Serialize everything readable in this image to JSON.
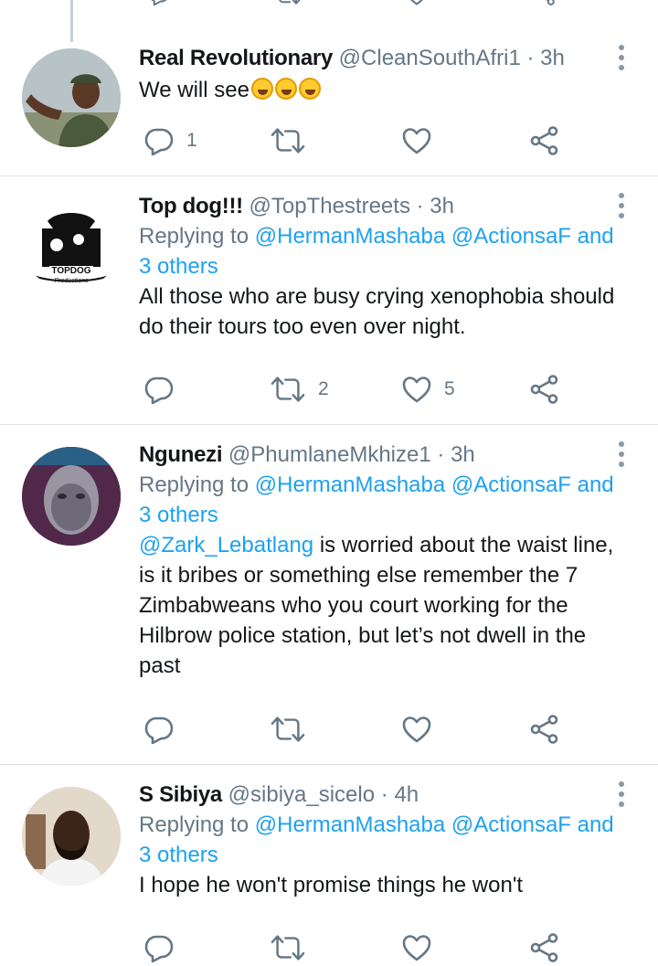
{
  "colors": {
    "accent": "#1da1f2",
    "secondary": "#657786",
    "divider": "#dfe3e7"
  },
  "tweets": [
    {
      "name": "Real Revolutionary",
      "handle": "@CleanSouthAfri1",
      "dot": "·",
      "time": "3h",
      "text": "We will see",
      "emoji": [
        "rolling-on-floor-laughing",
        "rolling-on-floor-laughing",
        "rolling-on-floor-laughing"
      ],
      "reply_count": "1",
      "retweet_count": "",
      "like_count": ""
    },
    {
      "name": "Top dog!!!",
      "handle": "@TopThestreets",
      "dot": "·",
      "time": "3h",
      "replying_prefix": "Replying to",
      "replying_to": "@HermanMashaba @ActionsaF and 3 others",
      "text": "All those who are busy crying xenophobia should do their tours too even over night.",
      "avatar_text": {
        "line1": "TOPDOG",
        "line2": "Productions"
      },
      "reply_count": "",
      "retweet_count": "2",
      "like_count": "5"
    },
    {
      "name": "Ngunezi",
      "handle": "@PhumlaneMkhize1",
      "dot": "·",
      "time": "3h",
      "replying_prefix": "Replying to",
      "replying_to": "@HermanMashaba @ActionsaF and 3 others",
      "mention": "@Zark_Lebatlang",
      "text": " is worried about the waist line, is it bribes or something else remember the 7 Zimbabweans who you court working for the Hilbrow police station, but let’s not dwell in the past",
      "reply_count": "",
      "retweet_count": "",
      "like_count": ""
    },
    {
      "name": "S Sibiya",
      "handle": "@sibiya_sicelo",
      "dot": "·",
      "time": "4h",
      "replying_prefix": "Replying to",
      "replying_to": "@HermanMashaba @ActionsaF and 3 others",
      "text": "I hope he won't promise things he won't",
      "reply_count": "",
      "retweet_count": "",
      "like_count": ""
    }
  ]
}
